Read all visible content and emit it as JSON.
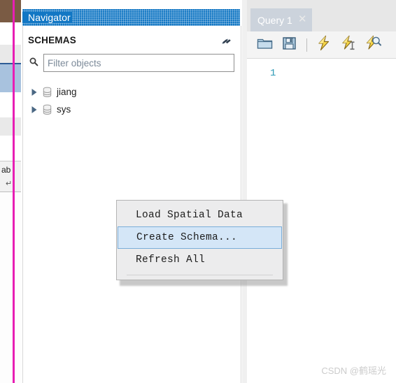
{
  "background_panel": {
    "clipped_label": "ab",
    "note": "partially visible window behind, clipped by left screenshot edge"
  },
  "annotation": {
    "type": "vertical-line",
    "color": "#e81eb4"
  },
  "navigator": {
    "title": "Navigator",
    "section_header": "SCHEMAS",
    "refresh_icon": "refresh-icon",
    "search_icon": "search-icon",
    "filter": {
      "value": "",
      "placeholder": "Filter objects"
    },
    "schemas": [
      {
        "name": "jiang",
        "icon": "database-icon",
        "expanded": false
      },
      {
        "name": "sys",
        "icon": "database-icon",
        "expanded": false
      }
    ]
  },
  "query_panel": {
    "tab": {
      "label": "Query 1",
      "close_icon": "close-icon"
    },
    "toolbar": [
      {
        "name": "open-sql-script-button",
        "icon": "folder-open-icon"
      },
      {
        "name": "save-sql-script-button",
        "icon": "floppy-save-icon"
      },
      {
        "name": "toolbar-separator",
        "icon": "separator"
      },
      {
        "name": "execute-statement-button",
        "icon": "lightning-icon"
      },
      {
        "name": "execute-current-statement-button",
        "icon": "lightning-cursor-icon"
      },
      {
        "name": "explain-statement-button",
        "icon": "lightning-magnifier-icon"
      }
    ],
    "editor": {
      "line_numbers": [
        "1"
      ],
      "content": ""
    }
  },
  "context_menu": {
    "items": [
      {
        "label": "Load Spatial Data",
        "selected": false
      },
      {
        "label": "Create Schema...",
        "selected": true
      },
      {
        "label": "Refresh All",
        "selected": false
      }
    ]
  },
  "watermark": {
    "text": "CSDN @鹤瑶光"
  },
  "colors": {
    "navigator_title_bg": "#1277c4",
    "menu_bg": "#ececed",
    "menu_selected_bg": "#d4e6f7",
    "menu_selected_border": "#7aadd9",
    "annotation": "#e81eb4",
    "line_number": "#2b99b5"
  }
}
